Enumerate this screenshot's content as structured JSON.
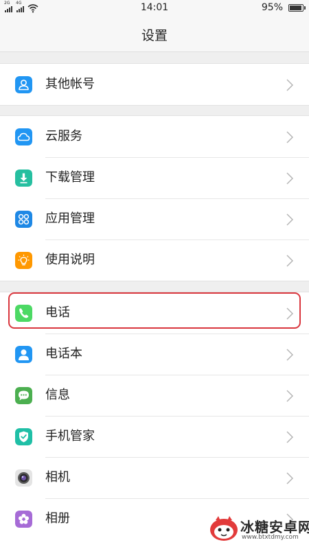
{
  "status_bar": {
    "sim1_network": "2G",
    "sim2_network": "4G",
    "time": "14:01",
    "battery_percent": "95%",
    "battery_level": 0.95
  },
  "header": {
    "title": "设置"
  },
  "groups": [
    {
      "items": [
        {
          "label": "其他帐号",
          "icon": "account-icon",
          "color": "#2196f3"
        }
      ]
    },
    {
      "items": [
        {
          "label": "云服务",
          "icon": "cloud-icon",
          "color": "#2196f3"
        },
        {
          "label": "下载管理",
          "icon": "download-icon",
          "color": "#26bfa0"
        },
        {
          "label": "应用管理",
          "icon": "apps-icon",
          "color": "#1e88e5"
        },
        {
          "label": "使用说明",
          "icon": "lightbulb-icon",
          "color": "#ff9800"
        }
      ]
    },
    {
      "items": [
        {
          "label": "电话",
          "icon": "phone-icon",
          "color": "#4cd964"
        },
        {
          "label": "电话本",
          "icon": "contacts-icon",
          "color": "#2196f3"
        },
        {
          "label": "信息",
          "icon": "message-icon",
          "color": "#4caf50"
        },
        {
          "label": "手机管家",
          "icon": "shield-icon",
          "color": "#1fbfa6"
        },
        {
          "label": "相机",
          "icon": "camera-icon",
          "color": "#9e9e9e"
        },
        {
          "label": "相册",
          "icon": "flower-icon",
          "color": "#a66bd6"
        }
      ]
    }
  ],
  "highlight_color": "#d9353d",
  "watermark": {
    "title": "冰糖安卓网",
    "url": "www.btxtdmy.com"
  }
}
